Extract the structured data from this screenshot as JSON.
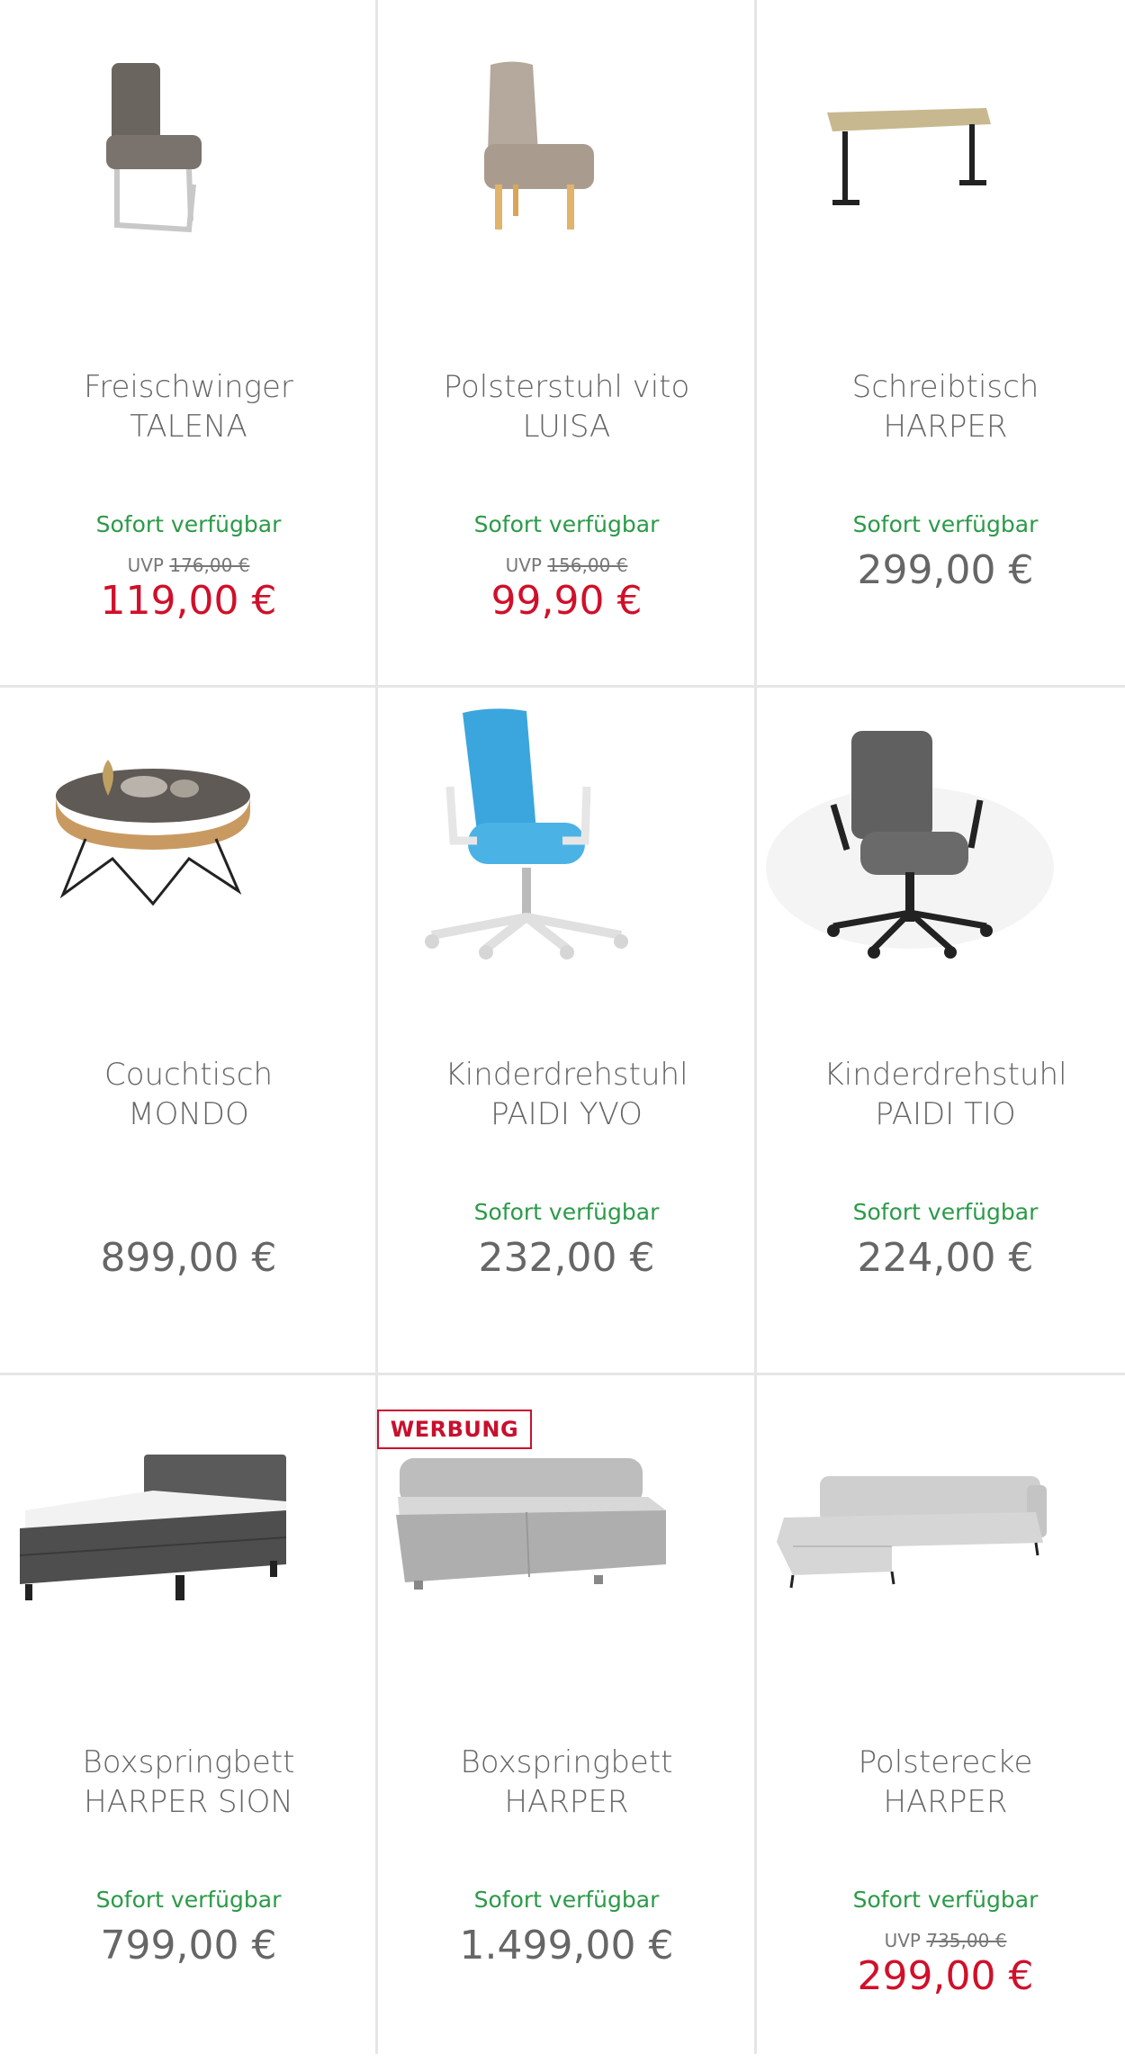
{
  "products": [
    {
      "title1": "Freischwinger",
      "title2": "TALENA",
      "availability": "Sofort verfügbar",
      "uvp_label": "UVP",
      "uvp_price": "176,00 €",
      "price": "119,00 €"
    },
    {
      "title1": "Polsterstuhl vito",
      "title2": "LUISA",
      "availability": "Sofort verfügbar",
      "uvp_label": "UVP",
      "uvp_price": "156,00 €",
      "price": "99,90 €"
    },
    {
      "title1": "Schreibtisch",
      "title2": "HARPER",
      "availability": "Sofort verfügbar",
      "price": "299,00 €"
    },
    {
      "title1": "Couchtisch",
      "title2": "MONDO",
      "price": "899,00 €"
    },
    {
      "title1": "Kinderdrehstuhl",
      "title2": "PAIDI YVO",
      "availability": "Sofort verfügbar",
      "price": "232,00 €"
    },
    {
      "title1": "Kinderdrehstuhl",
      "title2": "PAIDI TIO",
      "availability": "Sofort verfügbar",
      "price": "224,00 €"
    },
    {
      "title1": "Boxspringbett",
      "title2": "HARPER SION",
      "availability": "Sofort verfügbar",
      "price": "799,00 €"
    },
    {
      "title1": "Boxspringbett",
      "title2": "HARPER",
      "availability": "Sofort verfügbar",
      "price": "1.499,00 €",
      "badge": "WERBUNG"
    },
    {
      "title1": "Polsterecke",
      "title2": "HARPER",
      "availability": "Sofort verfügbar",
      "uvp_label": "UVP",
      "uvp_price": "735,00 €",
      "price": "299,00 €"
    }
  ],
  "colors": {
    "availability": "#2b9a48",
    "sale_price": "#d0102a",
    "badge": "#c8102e",
    "text": "#666666"
  }
}
